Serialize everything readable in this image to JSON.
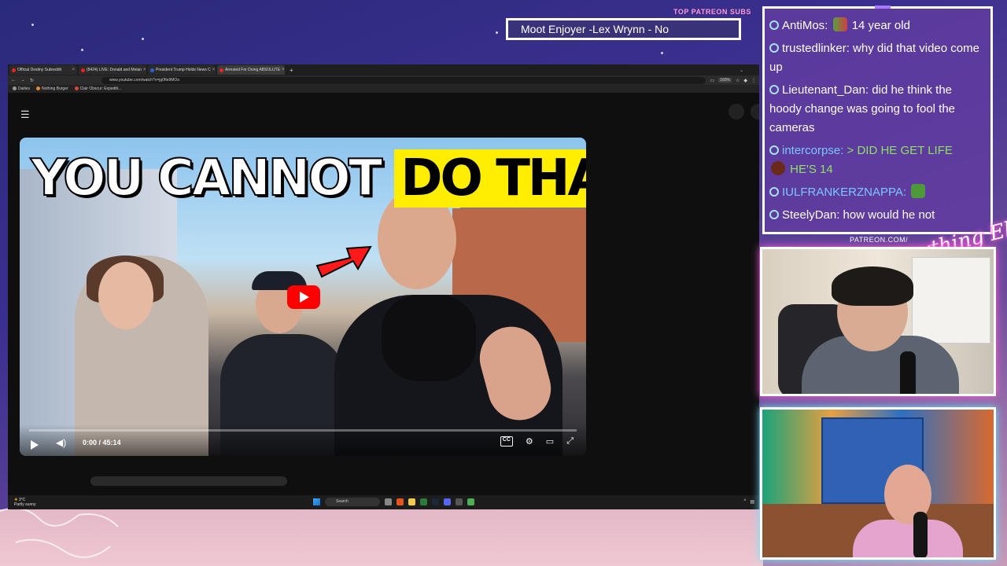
{
  "patreon_banner": {
    "label": "TOP PATREON SUBS",
    "ticker_text": "Moot Enjoyer -Lex Wrynn -  No"
  },
  "browser": {
    "tabs": [
      {
        "label": "Official Destiny Subreddit",
        "active": false
      },
      {
        "label": "(8424) LIVE: Donald and Melan",
        "active": false
      },
      {
        "label": "President Trump Holds News C",
        "active": false
      },
      {
        "label": "Arrested For Doing ABSOLUTE",
        "active": true
      }
    ],
    "url": "www.youtube.com/watch?v=jg0fte9MOo",
    "zoom": "160%",
    "bookmarks": [
      "Dailies",
      "Nothing Burger",
      "Clair Obscur: Expediti..."
    ]
  },
  "video": {
    "thumbnail_text_white": "YOU CANNOT",
    "thumbnail_text_yellow": "DO THAT",
    "time": "0:00 / 45:14",
    "cc_label": "CC"
  },
  "taskbar": {
    "weather_temp": "3°C",
    "weather_desc": "Partly sunny",
    "search_placeholder": "Search"
  },
  "chat": {
    "messages": [
      {
        "user": "AntiMos:",
        "text": "14 year old",
        "emote": true,
        "style": "normal"
      },
      {
        "user": "trustedlinker:",
        "text": "why did that video come up",
        "emote": false,
        "style": "normal"
      },
      {
        "user": "Lieutenant_Dan:",
        "text": "did he think the hoody change was going to fool the cameras",
        "emote": false,
        "style": "normal"
      },
      {
        "user": "intercorpse:",
        "text": "> DID HE GET LIFE",
        "text2": "HE'S 14",
        "emote": false,
        "style": "green"
      },
      {
        "user": "IULFRANKERZNAPPA:",
        "text": "",
        "emote": true,
        "style": "cyan"
      },
      {
        "user": "SteelyDan:",
        "text": "how would he not",
        "emote": false,
        "style": "normal"
      }
    ]
  },
  "branding": {
    "patreon_url": "PATREON.COM/",
    "brand_name": "Anything Else"
  },
  "colors": {
    "chat_bg": "#603ca0",
    "youtube_red": "#ff0000",
    "thumb_yellow": "#ffee00",
    "greentext": "#8fe066"
  }
}
